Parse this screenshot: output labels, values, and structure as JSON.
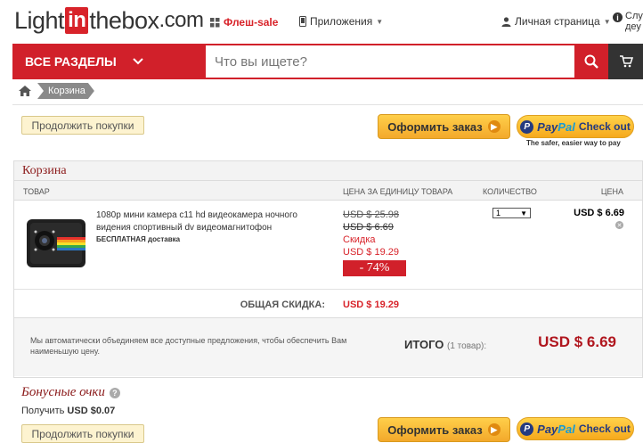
{
  "header": {
    "logo_light": "Light",
    "logo_in": "in",
    "logo_thebox": "thebox",
    "logo_com": ".com",
    "flash_sale": "Флеш-sale",
    "apps": "Приложения",
    "account": "Личная страница",
    "help_line1": "Слу",
    "help_line2": "деу"
  },
  "search": {
    "categories_label": "ВСЕ РАЗДЕЛЫ",
    "placeholder": "Что вы ищете?"
  },
  "breadcrumb": {
    "current": "Корзина"
  },
  "actions": {
    "continue_shopping": "Продолжить покупки",
    "checkout": "Оформить заказ",
    "paypal_pay": "Pay",
    "paypal_pal": "Pal",
    "paypal_checkout": "Check out",
    "paypal_tagline": "The safer, easier way to pay"
  },
  "cart": {
    "title": "Корзина",
    "columns": {
      "product": "ТОВАР",
      "unit_price": "ЦЕНА ЗА ЕДИНИЦУ ТОВАРА",
      "quantity": "КОЛИЧЕСТВО",
      "price": "ЦЕНА"
    },
    "items": [
      {
        "name": "1080p мини камера c11 hd видеокамера ночного видения спортивный dv видеомагнитофон",
        "shipping": "БЕСПЛАТНАЯ доставка",
        "original_price": "USD $ 25.98",
        "sale_price": "USD $ 6.69",
        "discount_label": "Скидка",
        "discount_amount": "USD $ 19.29",
        "discount_percent": "- 74%",
        "quantity": "1",
        "line_total": "USD $ 6.69"
      }
    ],
    "total_discount_label": "ОБЩАЯ СКИДКА:",
    "total_discount_value": "USD $ 19.29",
    "total_note": "Мы автоматически объединяем все доступные предложения, чтобы обеспечить Вам наименьшую цену.",
    "total_label": "ИТОГО",
    "total_count": "(1 товар):",
    "total_value": "USD $ 6.69"
  },
  "bonus": {
    "title": "Бонусные очки",
    "get_label": "Получить",
    "get_value": "USD $0.07"
  },
  "colors": {
    "brand_red": "#d1202a",
    "checkout_yellow": "#f3a92b",
    "title_maroon": "#8b1a1a"
  }
}
